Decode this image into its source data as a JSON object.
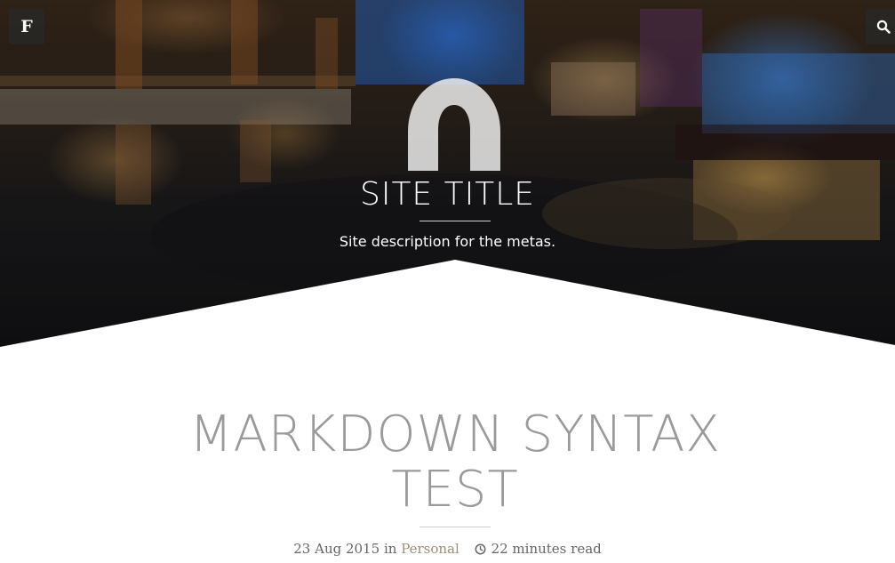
{
  "header": {
    "menu_letter": "F",
    "menu_icon": "letter-f-menu-icon",
    "search_icon": "search-icon"
  },
  "hero": {
    "site_title": "SITE TITLE",
    "site_description": "Site description for the metas."
  },
  "post": {
    "title": "MARKDOWN SYNTAX TEST",
    "date": "23 Aug 2015",
    "in_label": "in",
    "category": "Personal",
    "read_time": "22 minutes read"
  },
  "colors": {
    "title_gray": "#9a9a9a",
    "meta_gray": "#666666",
    "category_link": "#9a8f7a",
    "button_bg": "#282828"
  }
}
